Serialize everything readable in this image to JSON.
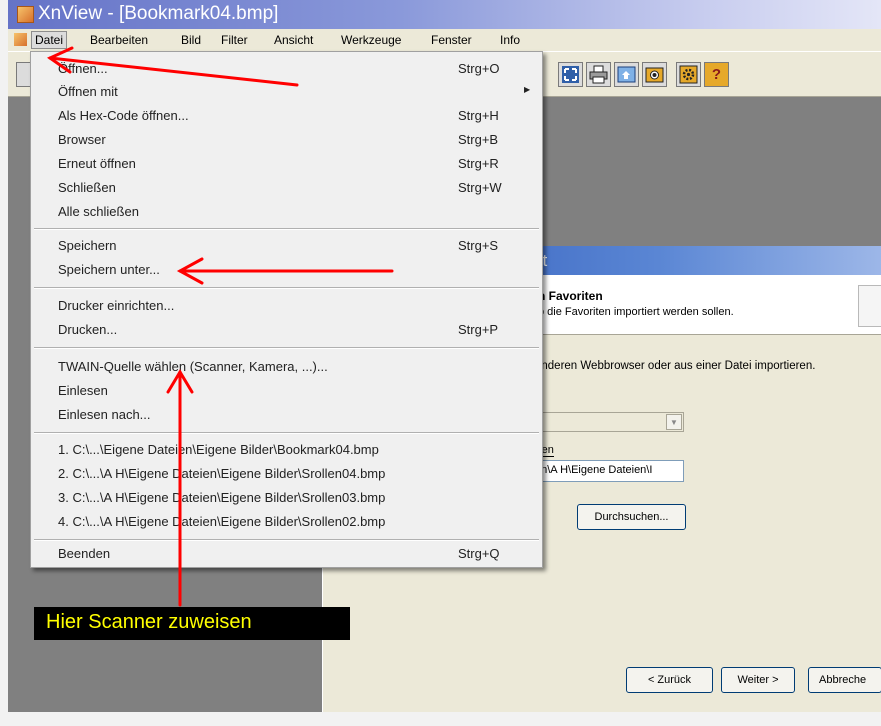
{
  "app": {
    "title": "XnView - [Bookmark04.bmp]"
  },
  "menubar": {
    "items": [
      {
        "label": "Datei"
      },
      {
        "label": "Bearbeiten"
      },
      {
        "label": "Bild"
      },
      {
        "label": "Filter"
      },
      {
        "label": "Ansicht"
      },
      {
        "label": "Werkzeuge"
      },
      {
        "label": "Fenster"
      },
      {
        "label": "Info"
      }
    ]
  },
  "toolbar": {
    "icons": [
      "fullscreen-icon",
      "print-icon",
      "scan-icon",
      "camera-icon",
      "settings-icon",
      "help-icon"
    ],
    "help_glyph": "?"
  },
  "file_menu": {
    "items": [
      {
        "label": "Öffnen...",
        "shortcut": "Strg+O"
      },
      {
        "label": "Öffnen mit",
        "shortcut": ""
      },
      {
        "label": "Als Hex-Code öffnen...",
        "shortcut": "Strg+H"
      },
      {
        "label": "Browser",
        "shortcut": "Strg+B"
      },
      {
        "label": "Erneut öffnen",
        "shortcut": "Strg+R"
      },
      {
        "label": "Schließen",
        "shortcut": "Strg+W"
      },
      {
        "label": "Alle schließen",
        "shortcut": ""
      },
      {
        "label": "Speichern",
        "shortcut": "Strg+S"
      },
      {
        "label": "Speichern unter...",
        "shortcut": ""
      },
      {
        "label": "Drucker einrichten...",
        "shortcut": ""
      },
      {
        "label": "Drucken...",
        "shortcut": "Strg+P"
      },
      {
        "label": "TWAIN-Quelle wählen (Scanner, Kamera, ...)...",
        "shortcut": ""
      },
      {
        "label": "Einlesen",
        "shortcut": ""
      },
      {
        "label": "Einlesen nach...",
        "shortcut": ""
      },
      {
        "label": "1. C:\\...\\Eigene Dateien\\Eigene Bilder\\Bookmark04.bmp",
        "shortcut": ""
      },
      {
        "label": "2. C:\\...\\A H\\Eigene Dateien\\Eigene Bilder\\Srollen04.bmp",
        "shortcut": ""
      },
      {
        "label": "3. C:\\...\\A H\\Eigene Dateien\\Eigene Bilder\\Srollen03.bmp",
        "shortcut": ""
      },
      {
        "label": "4. C:\\...\\A H\\Eigene Dateien\\Eigene Bilder\\Srollen02.bmp",
        "shortcut": ""
      },
      {
        "label": "Beenden",
        "shortcut": "Strg+Q"
      }
    ],
    "submenu_arrow": "▶"
  },
  "wizard": {
    "title_fragment": "nt",
    "heading_fragment": "n Favoriten",
    "subheading_fragment": "o die Favoriten importiert werden sollen.",
    "body_fragment": "anderen Webbrowser oder aus einer Datei importieren.",
    "combo_arrow": "▼",
    "radio_label_fragment": "ren",
    "path_value_fragment": "en\\A H\\Eigene Dateien\\I",
    "browse_button": "Durchsuchen...",
    "back_button": "< Zurück",
    "next_button": "Weiter >",
    "cancel_button_fragment": "Abbreche"
  },
  "annotation": {
    "label": "Hier Scanner zuweisen",
    "arrow_color": "#ff0000",
    "label_text_color": "#ffff00"
  }
}
